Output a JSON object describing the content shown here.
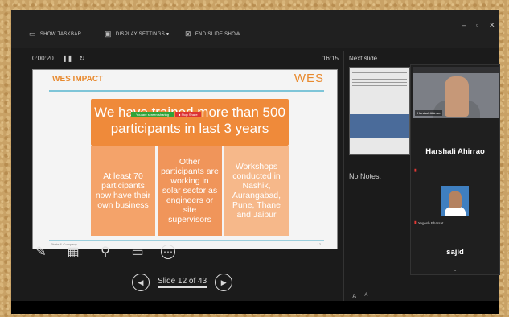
{
  "toolbar": {
    "show_taskbar": "SHOW TASKBAR",
    "display_settings": "DISPLAY SETTINGS ▾",
    "end_slide_show": "END SLIDE SHOW"
  },
  "presenter": {
    "elapsed_time": "0:00:20",
    "clock": "16:15",
    "slide_counter": "Slide 12 of 43"
  },
  "slide": {
    "header": "WES IMPACT",
    "logo": "WES",
    "headline": "We have trained more than 500 participants in last 3 years",
    "share_bar": {
      "sharing_text": "You are screen sharing",
      "stop_label": "■ Stop Share"
    },
    "columns": [
      "At least 70 participants now have their own business",
      "Other participants are working in solar sector as engineers or site supervisors",
      "Workshops conducted in Nashik, Aurangabad, Pune, Thane and Jaipur"
    ],
    "footer_text": "Pirate & Company",
    "page_no": "12"
  },
  "notes_pane": {
    "next_slide_label": "Next slide",
    "notes_text": "No Notes.",
    "font_increase": "A",
    "font_decrease": "A"
  },
  "participants": [
    {
      "name": "Harshali Ahirrao",
      "tile_label": "Harshali Ahirrao"
    },
    {
      "name": "Yogesh Bharsat",
      "tile_label": "Yogesh Bharsat"
    },
    {
      "name": "sajid",
      "tile_label": "sajid"
    }
  ],
  "icons": {
    "pen": "pen-icon",
    "slides_grid": "slides-grid-icon",
    "zoom": "magnifier-icon",
    "screen": "black-screen-icon",
    "more": "more-options-icon",
    "prev": "previous-icon",
    "next": "next-icon",
    "pause": "pause-icon",
    "restart": "restart-icon"
  },
  "colors": {
    "slide_accent": "#ef8a3a",
    "rule_blue": "#7ec5d8"
  }
}
